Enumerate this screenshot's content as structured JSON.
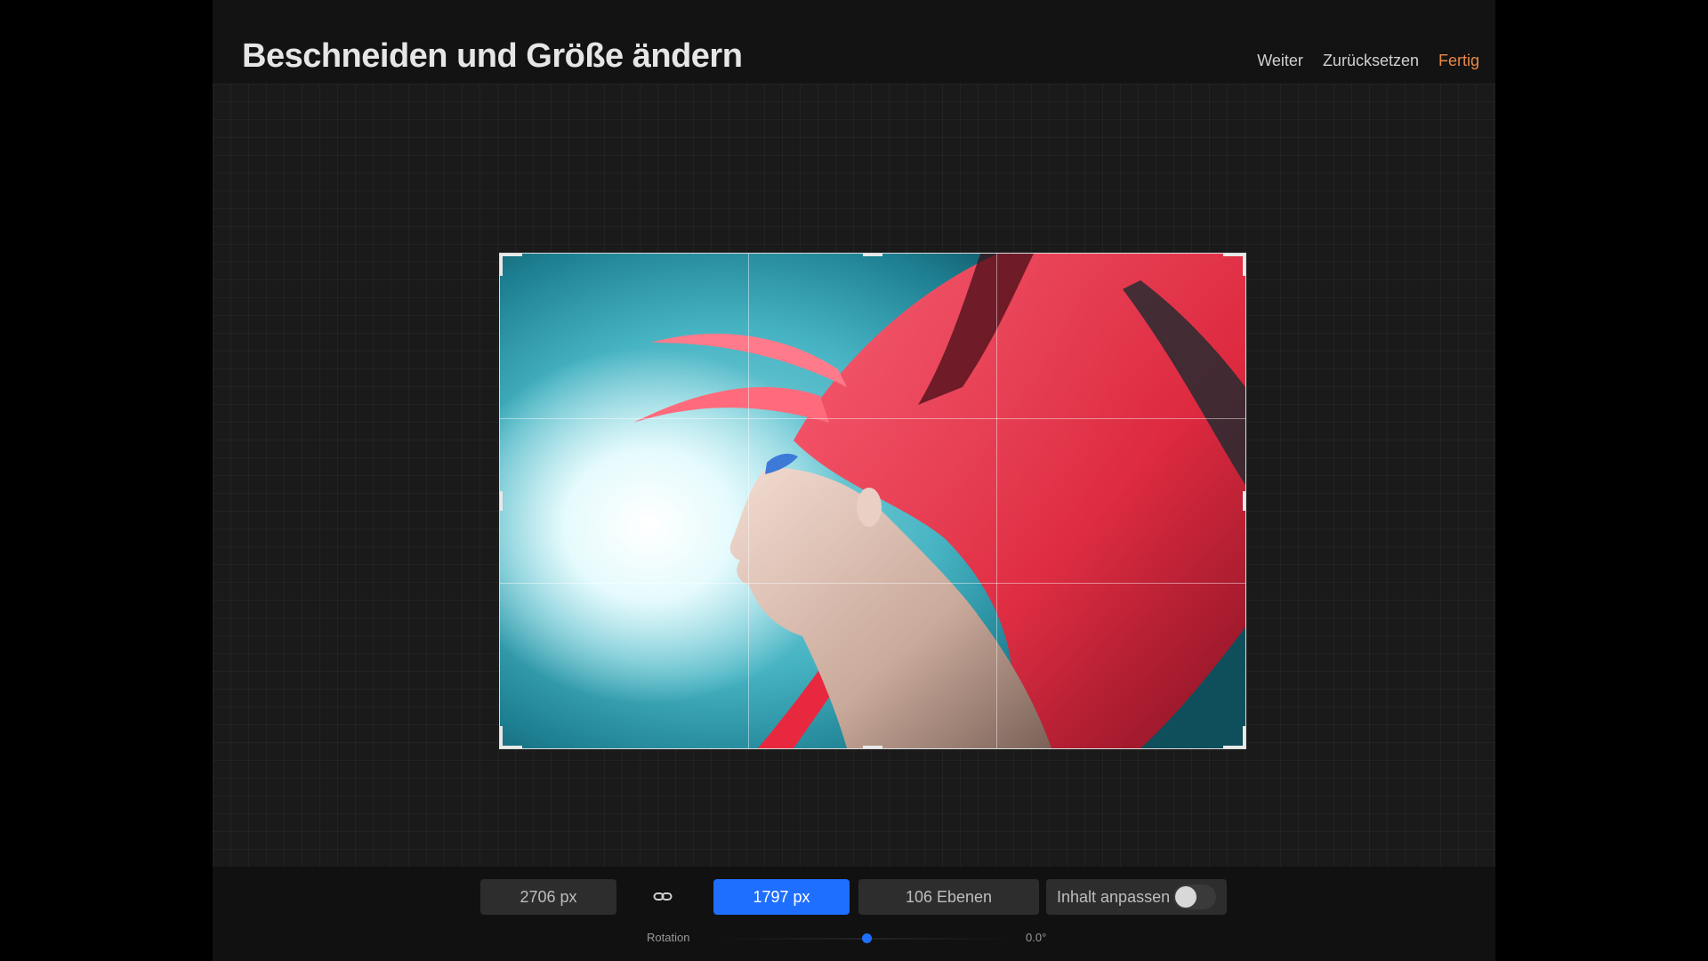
{
  "header": {
    "title": "Beschneiden und Größe ändern",
    "actions": {
      "next": "Weiter",
      "reset": "Zurücksetzen",
      "done": "Fertig"
    }
  },
  "canvas": {
    "grid": "rule-of-thirds"
  },
  "toolbar": {
    "width_value": "2706 px",
    "link_icon": "link-icon",
    "height_value": "1797 px",
    "layers_value": "106 Ebenen",
    "fit_content_label": "Inhalt anpassen",
    "fit_content_enabled": false,
    "rotation_label": "Rotation",
    "rotation_value": "0.0°",
    "rotation_level": 0.5
  },
  "colors": {
    "accent_done": "#e8894a",
    "active_field": "#1f6fff",
    "background": "#181818"
  }
}
